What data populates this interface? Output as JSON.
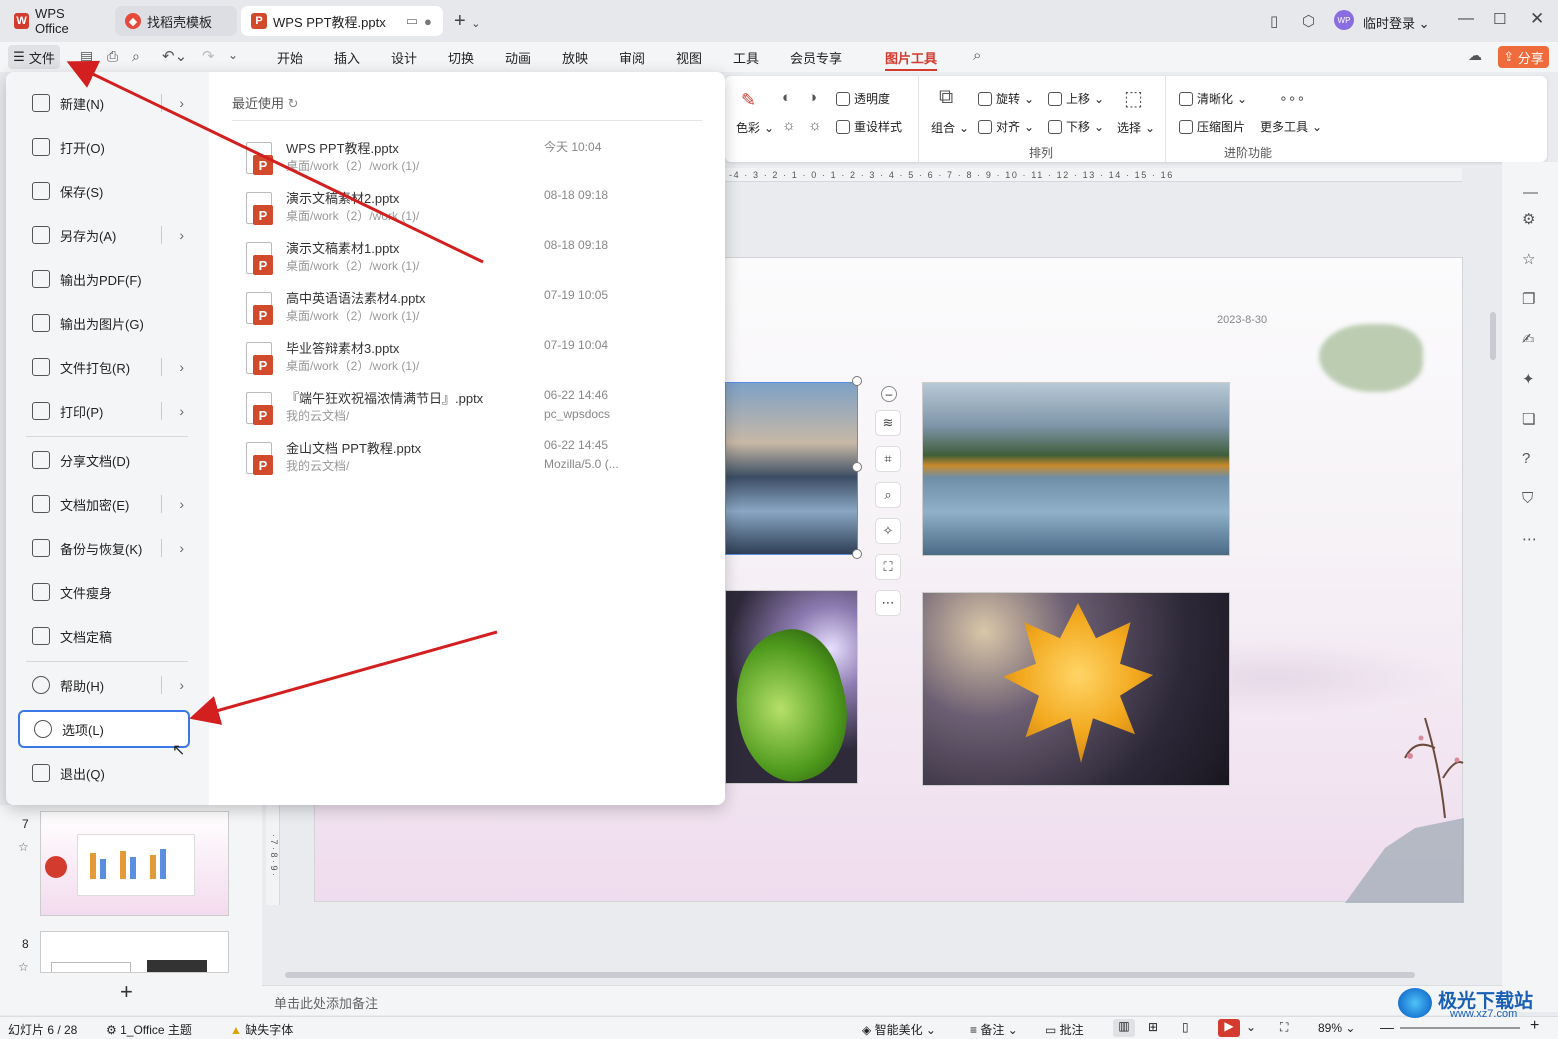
{
  "tabs": {
    "wps": "WPS Office",
    "template": "找稻壳模板",
    "doc": "WPS PPT教程.pptx",
    "add": "+",
    "user": "临时登录",
    "avatar": "WP"
  },
  "menubar": {
    "file": "文件",
    "items": [
      "开始",
      "插入",
      "设计",
      "切换",
      "动画",
      "放映",
      "审阅",
      "视图",
      "工具",
      "会员专享",
      "图片工具"
    ],
    "share": "分享"
  },
  "ribbon": {
    "transparency": "透明度",
    "color": "色彩",
    "reset": "重设样式",
    "combine": "组合",
    "rotate": "旋转",
    "align": "对齐",
    "up": "上移",
    "down": "下移",
    "select": "选择",
    "arrange": "排列",
    "clarify": "清晰化",
    "compress": "压缩图片",
    "more": "更多工具",
    "advanced": "进阶功能"
  },
  "ruler": "-4 · 3 · 2 · 1 · 0 · 1 · 2 · 3 · 4 · 5 · 6 · 7 · 8 · 9 · 10 · 11 · 12 · 13 · 14 · 15 · 16",
  "slide": {
    "date": "2023-8-30"
  },
  "filemenu": {
    "items": [
      {
        "label": "新建(N)",
        "icon": "new-icon",
        "arrow": true
      },
      {
        "label": "打开(O)",
        "icon": "folder-icon",
        "arrow": false
      },
      {
        "label": "保存(S)",
        "icon": "save-icon",
        "arrow": false
      },
      {
        "label": "另存为(A)",
        "icon": "save-as-icon",
        "arrow": true
      },
      {
        "label": "输出为PDF(F)",
        "icon": "pdf-icon",
        "arrow": false
      },
      {
        "label": "输出为图片(G)",
        "icon": "image-icon",
        "arrow": false
      },
      {
        "label": "文件打包(R)",
        "icon": "package-icon",
        "arrow": true
      },
      {
        "label": "打印(P)",
        "icon": "print-icon",
        "arrow": true
      },
      {
        "label": "分享文档(D)",
        "icon": "share-icon",
        "arrow": false
      },
      {
        "label": "文档加密(E)",
        "icon": "lock-icon",
        "arrow": true
      },
      {
        "label": "备份与恢复(K)",
        "icon": "backup-icon",
        "arrow": true
      },
      {
        "label": "文件瘦身",
        "icon": "slim-icon",
        "arrow": false
      },
      {
        "label": "文档定稿",
        "icon": "finalize-icon",
        "arrow": false
      },
      {
        "label": "帮助(H)",
        "icon": "help-icon",
        "arrow": true
      },
      {
        "label": "选项(L)",
        "icon": "gear-icon",
        "arrow": false
      },
      {
        "label": "退出(Q)",
        "icon": "exit-icon",
        "arrow": false
      }
    ],
    "recent_title": "最近使用",
    "recent": [
      {
        "name": "WPS PPT教程.pptx",
        "path": "桌面/work（2）/work (1)/",
        "time": "今天  10:04",
        "extra": ""
      },
      {
        "name": "演示文稿素材2.pptx",
        "path": "桌面/work（2）/work (1)/",
        "time": "08-18 09:18",
        "extra": ""
      },
      {
        "name": "演示文稿素材1.pptx",
        "path": "桌面/work（2）/work (1)/",
        "time": "08-18 09:18",
        "extra": ""
      },
      {
        "name": "高中英语语法素材4.pptx",
        "path": "桌面/work（2）/work (1)/",
        "time": "07-19 10:05",
        "extra": ""
      },
      {
        "name": "毕业答辩素材3.pptx",
        "path": "桌面/work（2）/work (1)/",
        "time": "07-19 10:04",
        "extra": ""
      },
      {
        "name": "『端午狂欢祝福浓情满节日』.pptx",
        "path": "我的云文档/",
        "time": "06-22 14:46",
        "extra": "pc_wpsdocs"
      },
      {
        "name": "金山文档 PPT教程.pptx",
        "path": "我的云文档/",
        "time": "06-22 14:45",
        "extra": "Mozilla/5.0 (..."
      }
    ]
  },
  "thumbs": {
    "n7": "7",
    "n8": "8",
    "add": "+"
  },
  "notes": "单击此处添加备注",
  "status": {
    "slide": "幻灯片 6 / 28",
    "theme": "1_Office 主题",
    "font": "缺失字体",
    "beautify": "智能美化",
    "notes": "备注",
    "comment": "批注",
    "zoom": "89%"
  },
  "watermark": {
    "name": "极光下载站",
    "url": "www.xz7.com"
  },
  "colors": {
    "accent": "#d33b2f",
    "selected": "#3b78e7"
  }
}
